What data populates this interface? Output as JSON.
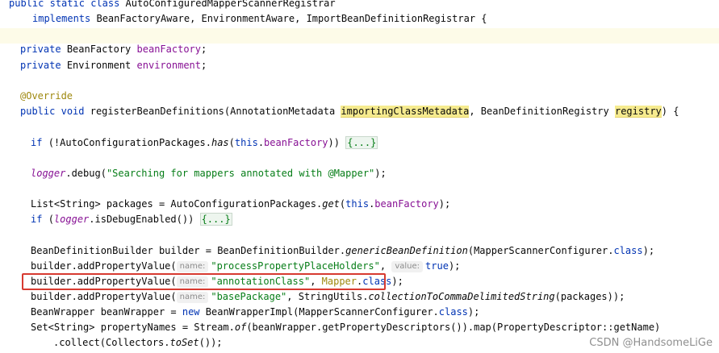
{
  "code": {
    "l0": {
      "kw1": "public",
      "kw2": "static",
      "kw3": "class",
      "name": "AutoConfiguredMapperScannerRegistrar"
    },
    "l1": {
      "kw": "implements",
      "rest": "BeanFactoryAware, EnvironmentAware, ImportBeanDefinitionRegistrar {"
    },
    "l3": {
      "kw": "private",
      "type": "BeanFactory",
      "field": "beanFactory",
      "end": ";"
    },
    "l4": {
      "kw": "private",
      "type": "Environment",
      "field": "environment",
      "end": ";"
    },
    "l6": {
      "annotation": "@Override"
    },
    "l7": {
      "kw1": "public",
      "kw2": "void",
      "method": "registerBeanDefinitions(AnnotationMetadata",
      "param1": "importingClassMetadata",
      "mid": ", BeanDefinitionRegistry",
      "param2": "registry",
      "end": ") {"
    },
    "l9": {
      "kw": "if",
      "pre": "(!AutoConfigurationPackages.",
      "call": "has",
      "open": "(",
      "this": "this",
      "dot": ".",
      "field": "beanFactory",
      "close": "))",
      "fold": "{...}"
    },
    "l11": {
      "logger": "logger",
      "pre": ".debug(",
      "str": "\"Searching for mappers annotated with @Mapper\"",
      "end": ");"
    },
    "l13": {
      "pre": "List<String> packages = AutoConfigurationPackages.",
      "call": "get",
      "open": "(",
      "this": "this",
      "dot": ".",
      "field": "beanFactory",
      "end": ");"
    },
    "l14": {
      "kw": "if",
      "open": "(",
      "logger": "logger",
      "rest": ".isDebugEnabled())",
      "fold": "{...}"
    },
    "l16": {
      "pre": "BeanDefinitionBuilder builder = BeanDefinitionBuilder.",
      "call": "genericBeanDefinition",
      "mid": "(MapperScannerConfigurer.",
      "kw": "class",
      "end": ");"
    },
    "l17": {
      "pre": "builder.addPropertyValue(",
      "hint1": "name:",
      "str": "\"processPropertyPlaceHolders\"",
      "comma": ",",
      "hint2": "value:",
      "kw": "true",
      "end": ");"
    },
    "l18": {
      "pre": "builder.addPropertyValue(",
      "hint1": "name:",
      "str": "\"annotationClass\"",
      "comma": ",",
      "cls": "Mapper",
      "dot": ".",
      "kw": "class",
      "end": ");"
    },
    "l19": {
      "pre": "builder.addPropertyValue(",
      "hint1": "name:",
      "str": "\"basePackage\"",
      "mid": ", StringUtils.",
      "call": "collectionToCommaDelimitedString",
      "end": "(packages));"
    },
    "l20": {
      "pre": "BeanWrapper beanWrapper =",
      "kw": "new",
      "mid": "BeanWrapperImpl(MapperScannerConfigurer.",
      "kw2": "class",
      "end": ");"
    },
    "l21": {
      "pre": "Set<String> propertyNames = Stream.",
      "call": "of",
      "end": "(beanWrapper.getPropertyDescriptors()).map(PropertyDescriptor::getName)"
    },
    "l22": {
      "pre": ".collect(Collectors.",
      "call": "toSet",
      "end": "());"
    }
  },
  "watermark": "CSDN @HandsomeLiGe",
  "colors": {
    "keyword": "#0033b3",
    "annotation": "#9e880d",
    "field": "#871094",
    "string": "#067d17",
    "highlight_box": "#d73a30",
    "caret_row": "#fdfbe8"
  }
}
